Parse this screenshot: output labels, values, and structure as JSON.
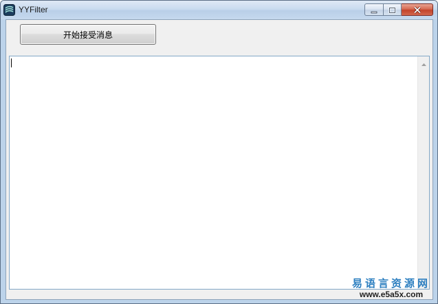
{
  "window": {
    "title": "YYFilter",
    "icon": "app-logo-icon"
  },
  "title_controls": {
    "minimize_icon": "minimize-icon",
    "maximize_icon": "maximize-icon",
    "close_icon": "close-icon"
  },
  "toolbar": {
    "start_label": "开始接受消息"
  },
  "message_box": {
    "value": ""
  },
  "watermark": {
    "name": "易语言资源网",
    "url": "www.e5a5x.com"
  }
}
